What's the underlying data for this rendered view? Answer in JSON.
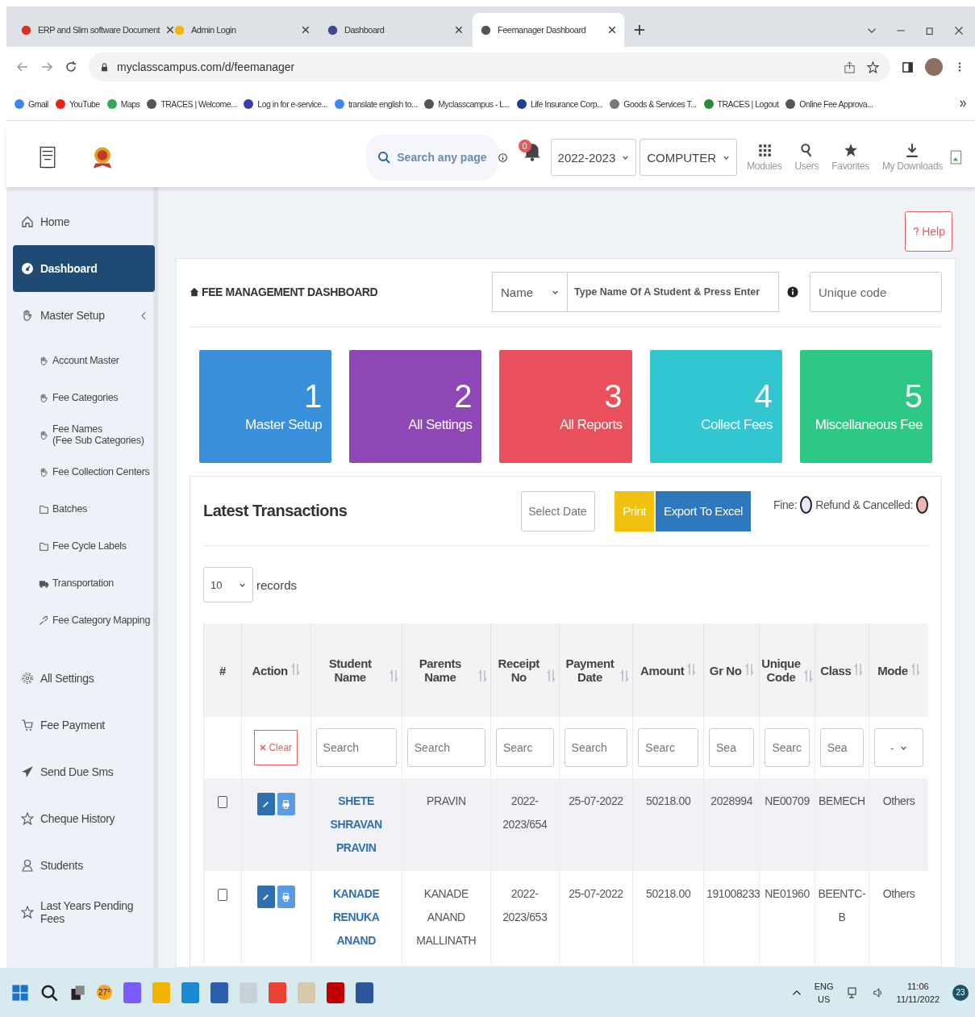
{
  "browser": {
    "tabs": [
      {
        "title": "ERP and Slim software Document",
        "selected": false
      },
      {
        "title": "Admin Login",
        "selected": false
      },
      {
        "title": "Dashboard",
        "selected": false
      },
      {
        "title": "Feemanager Dashboard",
        "selected": true
      }
    ],
    "url": "myclasscampus.com/d/feemanager",
    "bookmarks": [
      "Gmail",
      "YouTube",
      "Maps",
      "TRACES | Welcome...",
      "Log in for e-service...",
      "translate english to...",
      "Myclasscampus - L...",
      "Life Insurance Corp...",
      "Goods & Services T...",
      "TRACES | Logout",
      "Online Fee Approva..."
    ]
  },
  "header": {
    "search_placeholder": "Search any page",
    "notification_count": "0",
    "year": "2022-2023",
    "department": "COMPUTER",
    "nav": [
      "Modules",
      "Users",
      "Favorites",
      "My Downloads"
    ]
  },
  "sidebar": {
    "items": [
      {
        "label": "Home",
        "selected": false
      },
      {
        "label": "Dashboard",
        "selected": true
      },
      {
        "label": "Master Setup",
        "selected": false,
        "expanded": true,
        "children": [
          {
            "label": "Account Master",
            "selected": false
          },
          {
            "label": "Fee Categories",
            "selected": false
          },
          {
            "label": "Fee Names\n(Fee Sub Categories)",
            "selected": false
          },
          {
            "label": "Fee Collection Centers",
            "selected": false
          },
          {
            "label": "Batches",
            "selected": false
          },
          {
            "label": "Fee Cycle Labels",
            "selected": false
          },
          {
            "label": "Transportation",
            "selected": false
          },
          {
            "label": "Fee Category Mapping",
            "selected": false
          }
        ]
      },
      {
        "label": "All Settings",
        "selected": false
      },
      {
        "label": "Fee Payment",
        "selected": false
      },
      {
        "label": "Send Due Sms",
        "selected": false
      },
      {
        "label": "Cheque History",
        "selected": false
      },
      {
        "label": "Students",
        "selected": false
      },
      {
        "label": "Last Years Pending Fees",
        "selected": false
      }
    ]
  },
  "help_button": "Help",
  "dashboard": {
    "title": "FEE MANAGEMENT DASHBOARD",
    "search_by": "Name",
    "search_placeholder": "Type Name Of A Student & Press Enter",
    "code_placeholder": "Unique code",
    "tiles": [
      {
        "number": "1",
        "label": "Master Setup",
        "color": "#3a8fdb"
      },
      {
        "number": "2",
        "label": "All Settings",
        "color": "#8e48b5"
      },
      {
        "number": "3",
        "label": "All Reports",
        "color": "#e8505b"
      },
      {
        "number": "4",
        "label": "Collect Fees",
        "color": "#31c6d0"
      },
      {
        "number": "5",
        "label": "Miscellaneous Fee",
        "color": "#2ec886"
      }
    ]
  },
  "transactions": {
    "title": "Latest Transactions",
    "date_placeholder": "Select Date",
    "print": "Print",
    "export": "Export To Excel",
    "legend": [
      {
        "label": "Fine:",
        "color": "#e8e6fb"
      },
      {
        "label": "Refund & Cancelled:",
        "color": "#efb6b6"
      }
    ],
    "page_size": "10",
    "records_label": "records",
    "columns": [
      {
        "label": "#",
        "sortable": false
      },
      {
        "label": "Action",
        "sortable": true
      },
      {
        "label": "Student Name",
        "sortable": true
      },
      {
        "label": "Parents Name",
        "sortable": true
      },
      {
        "label": "Receipt No",
        "sortable": true
      },
      {
        "label": "Payment Date",
        "sortable": true
      },
      {
        "label": "Amount",
        "sortable": true
      },
      {
        "label": "Gr No",
        "sortable": true
      },
      {
        "label": "Unique Code",
        "sortable": true
      },
      {
        "label": "Class",
        "sortable": true
      },
      {
        "label": "Mode",
        "sortable": true
      }
    ],
    "clear": "Clear",
    "filters": [
      {
        "placeholder": "Search"
      },
      {
        "placeholder": "Search"
      },
      {
        "placeholder": "Searc"
      },
      {
        "placeholder": "Search"
      },
      {
        "placeholder": "Searc"
      },
      {
        "placeholder": "Sea"
      },
      {
        "placeholder": "Searc"
      },
      {
        "placeholder": "Sea"
      }
    ],
    "mode_filter": "-",
    "rows": [
      {
        "checked": false,
        "student_name": "SHETE SHRAVAN PRAVIN",
        "parents_name": "PRAVIN",
        "receipt_no": "2022-2023/654",
        "payment_date": "25-07-2022",
        "amount": "50218.00",
        "gr_no": "2028994",
        "unique_code": "NE00709",
        "class": "BEMECH",
        "mode": "Others"
      },
      {
        "checked": false,
        "student_name": "KANADE RENUKA ANAND",
        "parents_name": "KANADE ANAND MALLINATH",
        "receipt_no": "2022-2023/653",
        "payment_date": "25-07-2022",
        "amount": "50218.00",
        "gr_no": "191008233",
        "unique_code": "NE01960",
        "class": "BEENTC-B",
        "mode": "Others"
      }
    ]
  },
  "taskbar": {
    "weather": "27°",
    "language": "ENG",
    "region": "US",
    "time": "11:06",
    "date": "11/11/2022",
    "notification_count": "23"
  }
}
